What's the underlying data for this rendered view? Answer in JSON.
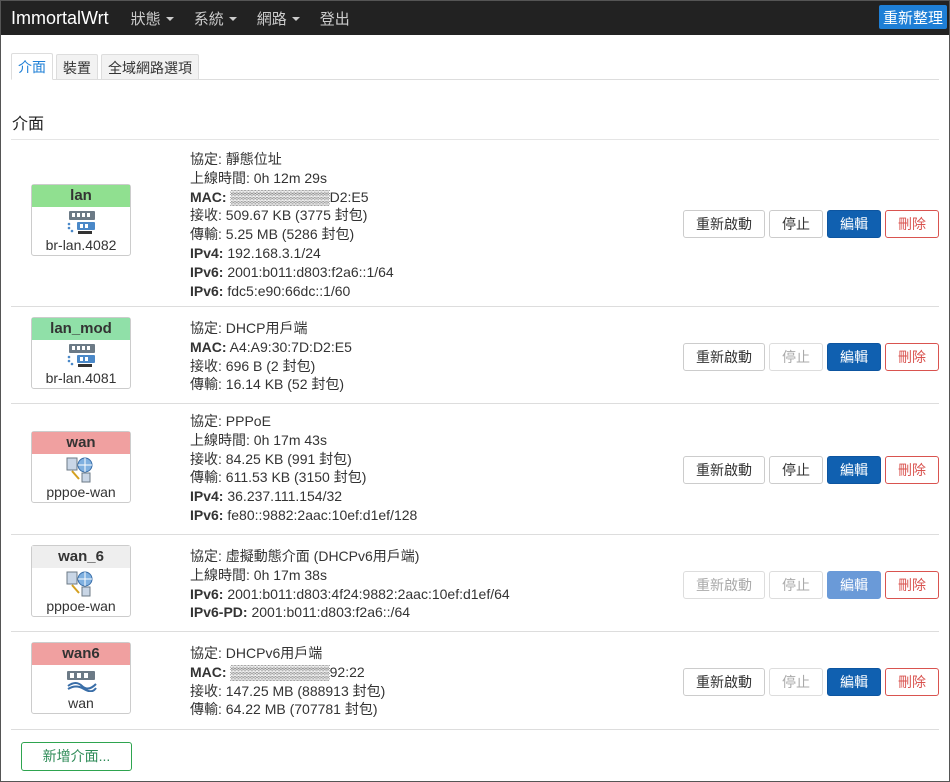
{
  "topbar": {
    "brand": "ImmortalWrt",
    "menu": [
      {
        "label": "狀態",
        "has_caret": true
      },
      {
        "label": "系統",
        "has_caret": true
      },
      {
        "label": "網路",
        "has_caret": true
      },
      {
        "label": "登出",
        "has_caret": false
      }
    ],
    "reload_label": "重新整理"
  },
  "tabs": [
    "介面",
    "裝置",
    "全域網路選項"
  ],
  "section_title": "介面",
  "actions": {
    "restart": "重新啟動",
    "stop": "停止",
    "edit": "編輯",
    "delete": "刪除"
  },
  "interfaces": [
    {
      "name": "lan",
      "device": "br-lan.4082",
      "color": "#90e090",
      "icon": "ethernet-switch-icon",
      "lines": [
        {
          "label": "協定:",
          "value": " 靜態位址",
          "bold": false
        },
        {
          "label": "上線時間:",
          "value": " 0h 12m 29s",
          "bold": false
        },
        {
          "label": "MAC:",
          "value": " ▒▒▒▒▒▒▒▒▒▒D2:E5",
          "bold": true
        },
        {
          "label": "接收:",
          "value": " 509.67 KB (3775 封包)",
          "bold": false
        },
        {
          "label": "傳輸:",
          "value": " 5.25 MB (5286 封包)",
          "bold": false
        },
        {
          "label": "IPv4:",
          "value": " 192.168.3.1/24",
          "bold": true
        },
        {
          "label": "IPv6:",
          "value": " 2001:b011:d803:f2a6::1/64",
          "bold": true
        },
        {
          "label": "IPv6:",
          "value": " fdc5:e90:66dc::1/60",
          "bold": true
        }
      ],
      "restart_enabled": true,
      "stop_enabled": true,
      "edit_dim": false
    },
    {
      "name": "lan_mod",
      "device": "br-lan.4081",
      "color": "#90e0a8",
      "icon": "ethernet-switch-icon",
      "lines": [
        {
          "label": "協定:",
          "value": " DHCP用戶端",
          "bold": false
        },
        {
          "label": "MAC:",
          "value": " A4:A9:30:7D:D2:E5",
          "bold": true
        },
        {
          "label": "接收:",
          "value": " 696 B (2 封包)",
          "bold": false
        },
        {
          "label": "傳輸:",
          "value": " 16.14 KB (52 封包)",
          "bold": false
        }
      ],
      "restart_enabled": true,
      "stop_enabled": false,
      "edit_dim": false
    },
    {
      "name": "wan",
      "device": "pppoe-wan",
      "color": "#f0a0a0",
      "icon": "pppoe-globe-icon",
      "lines": [
        {
          "label": "協定:",
          "value": " PPPoE",
          "bold": false
        },
        {
          "label": "上線時間:",
          "value": " 0h 17m 43s",
          "bold": false
        },
        {
          "label": "接收:",
          "value": " 84.25 KB (991 封包)",
          "bold": false
        },
        {
          "label": "傳輸:",
          "value": " 611.53 KB (3150 封包)",
          "bold": false
        },
        {
          "label": "IPv4:",
          "value": " 36.237.111.154/32",
          "bold": true
        },
        {
          "label": "IPv6:",
          "value": " fe80::9882:2aac:10ef:d1ef/128",
          "bold": true
        }
      ],
      "restart_enabled": true,
      "stop_enabled": true,
      "edit_dim": false
    },
    {
      "name": "wan_6",
      "device": "pppoe-wan",
      "color": "#eeeeee",
      "icon": "pppoe-globe-icon",
      "lines": [
        {
          "label": "協定:",
          "value": " 虛擬動態介面 (DHCPv6用戶端)",
          "bold": false
        },
        {
          "label": "上線時間:",
          "value": " 0h 17m 38s",
          "bold": false
        },
        {
          "label": "IPv6:",
          "value": " 2001:b011:d803:4f24:9882:2aac:10ef:d1ef/64",
          "bold": true
        },
        {
          "label": "IPv6-PD:",
          "value": " 2001:b011:d803:f2a6::/64",
          "bold": true
        }
      ],
      "restart_enabled": false,
      "stop_enabled": false,
      "edit_dim": true
    },
    {
      "name": "wan6",
      "device": "wan",
      "color": "#f0a0a0",
      "icon": "ethernet-port-icon",
      "lines": [
        {
          "label": "協定:",
          "value": " DHCPv6用戶端",
          "bold": false
        },
        {
          "label": "MAC:",
          "value": " ▒▒▒▒▒▒▒▒▒▒92:22",
          "bold": true
        },
        {
          "label": "接收:",
          "value": " 147.25 MB (888913 封包)",
          "bold": false
        },
        {
          "label": "傳輸:",
          "value": " 64.22 MB (707781 封包)",
          "bold": false
        }
      ],
      "restart_enabled": true,
      "stop_enabled": false,
      "edit_dim": false
    }
  ],
  "add_button": "新增介面..."
}
